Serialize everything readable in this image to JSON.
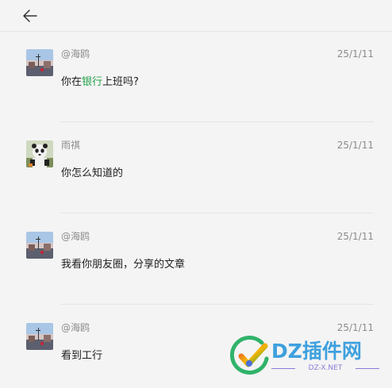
{
  "header": {
    "back_icon": "arrow-left-icon"
  },
  "messages": [
    {
      "name": "@海鸥",
      "time": "25/1/11",
      "text_before": "你在",
      "link": "银行",
      "text_after": "上班吗?",
      "avatar": "street-photo-avatar"
    },
    {
      "name": "雨祺",
      "time": "25/1/11",
      "text": "你怎么知道的",
      "avatar": "panda-avatar"
    },
    {
      "name": "@海鸥",
      "time": "25/1/11",
      "text": "我看你朋友圈，分享的文章",
      "avatar": "street-photo-avatar"
    },
    {
      "name": "@海鸥",
      "time": "25/1/11",
      "text": "看到工行",
      "avatar": "street-photo-avatar"
    }
  ],
  "watermark": {
    "title": "DZ插件网",
    "subtitle": "DZ-X.NET"
  },
  "colors": {
    "link": "#22a34a",
    "background": "#f4f4f4",
    "meta": "#8c8c8c"
  }
}
